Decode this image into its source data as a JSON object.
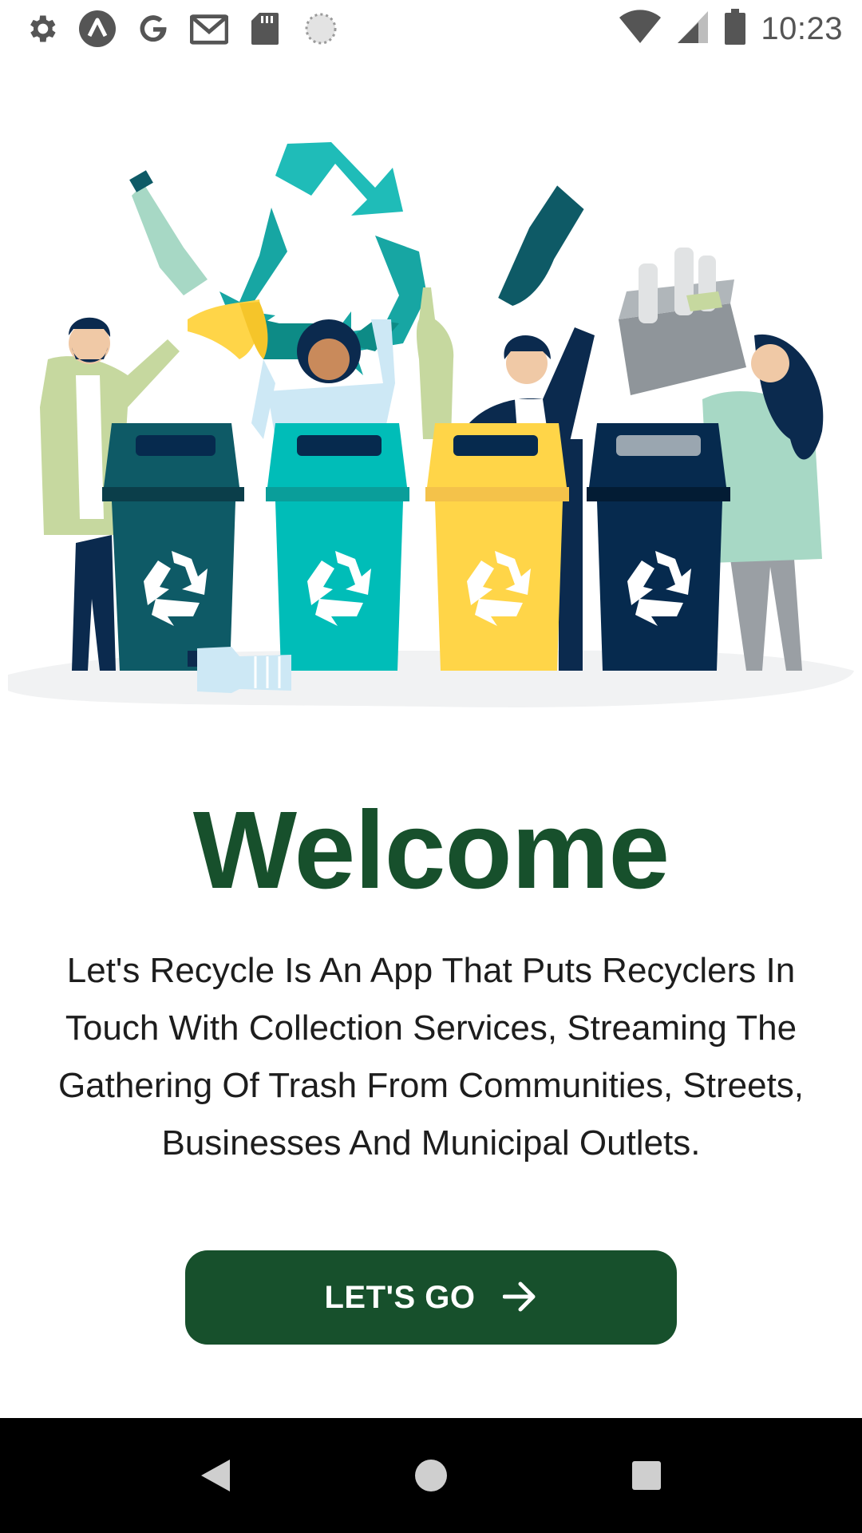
{
  "status_bar": {
    "time": "10:23",
    "left_icons": [
      "settings-icon",
      "app-logo-icon",
      "google-icon",
      "gmail-icon",
      "sd-card-icon",
      "loading-icon"
    ],
    "right_icons": [
      "wifi-icon",
      "cellular-signal-icon",
      "battery-icon"
    ]
  },
  "hero": {
    "illustration": "people-recycling-bins-illustration"
  },
  "main": {
    "title": "Welcome",
    "description": "Let's Recycle Is An App That Puts Recyclers In Touch With Collection Services, Streaming The Gathering Of Trash From Communities, Streets, Businesses And Municipal Outlets.",
    "cta_label": "LET'S GO",
    "cta_icon": "arrow-right-icon"
  },
  "nav_bar": {
    "buttons": [
      "back-icon",
      "home-icon",
      "recents-icon"
    ]
  },
  "colors": {
    "primary": "#17502c",
    "bin_dark_teal": "#0e5a66",
    "bin_teal": "#00bdb8",
    "bin_yellow": "#ffd548",
    "bin_navy": "#062a4e"
  }
}
